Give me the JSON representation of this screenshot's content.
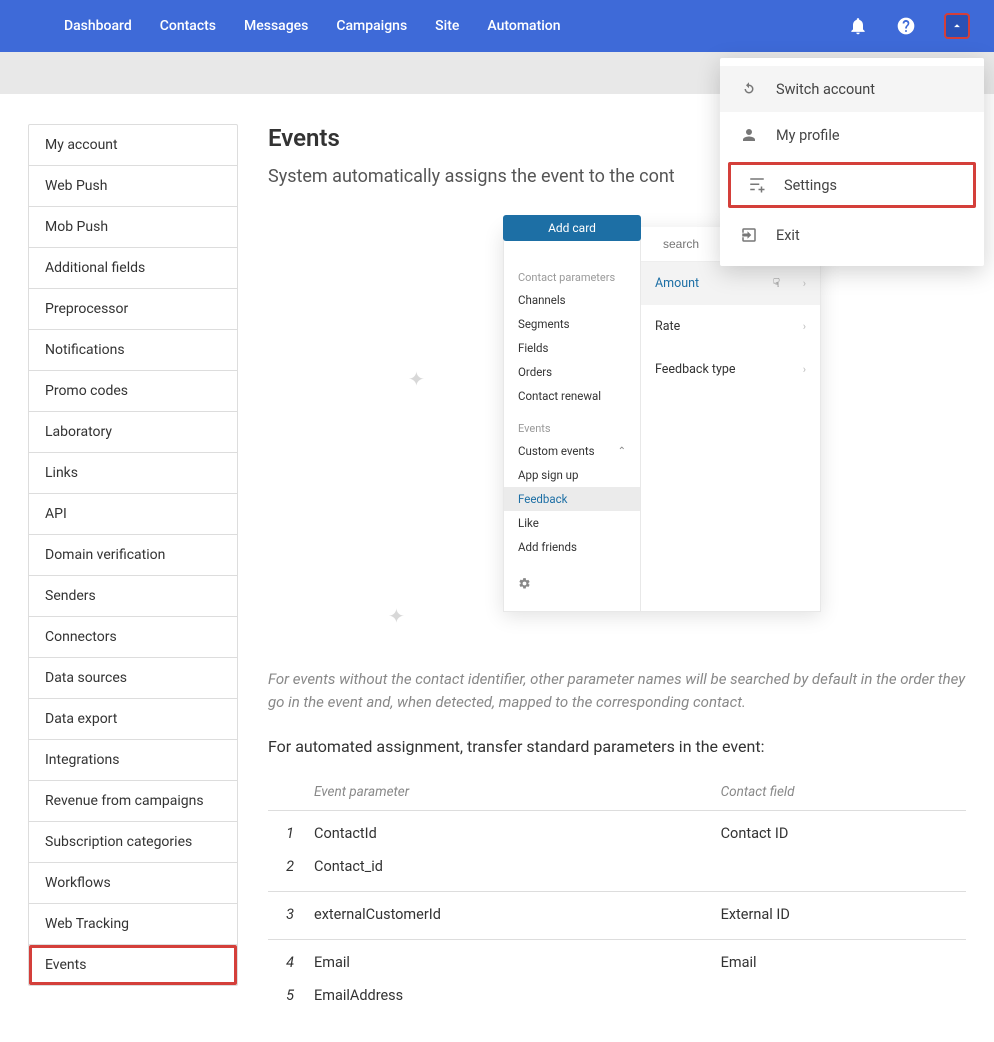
{
  "topnav": [
    "Dashboard",
    "Contacts",
    "Messages",
    "Campaigns",
    "Site",
    "Automation"
  ],
  "user_menu": {
    "switch": "Switch account",
    "profile": "My profile",
    "settings": "Settings",
    "exit": "Exit"
  },
  "sidebar": [
    "My account",
    "Web Push",
    "Mob Push",
    "Additional fields",
    "Preprocessor",
    "Notifications",
    "Promo codes",
    "Laboratory",
    "Links",
    "API",
    "Domain verification",
    "Senders",
    "Connectors",
    "Data sources",
    "Data export",
    "Integrations",
    "Revenue from campaigns",
    "Subscription categories",
    "Workflows",
    "Web Tracking",
    "Events"
  ],
  "page": {
    "title": "Events",
    "subtitle": "System automatically assigns the event to the cont"
  },
  "popup": {
    "add_card": "Add card",
    "section1": "Contact parameters",
    "contact_items": [
      "Channels",
      "Segments",
      "Fields",
      "Orders",
      "Contact renewal"
    ],
    "section2": "Events",
    "custom_events": "Custom events",
    "event_items": [
      "App sign up",
      "Feedback",
      "Like",
      "Add friends"
    ],
    "active_event": "Feedback",
    "search_placeholder": "search",
    "options": [
      "Amount",
      "Rate",
      "Feedback type"
    ],
    "active_option": "Amount"
  },
  "note": "For events without the contact identifier, other parameter names will be searched by default in the order they go in the event and, when detected, mapped to the corresponding contact.",
  "sub_heading": "For automated assignment, transfer standard parameters in the event:",
  "table": {
    "headers": [
      "",
      "Event parameter",
      "Contact field"
    ],
    "rows": [
      {
        "idx": "1",
        "param": "ContactId",
        "field": "Contact ID",
        "first": true
      },
      {
        "idx": "2",
        "param": "Contact_id",
        "field": "",
        "last": true
      },
      {
        "idx": "3",
        "param": "externalCustomerId",
        "field": "External ID",
        "first": true,
        "last": true
      },
      {
        "idx": "4",
        "param": "Email",
        "field": "Email",
        "first": true
      },
      {
        "idx": "5",
        "param": "EmailAddress",
        "field": ""
      }
    ]
  }
}
